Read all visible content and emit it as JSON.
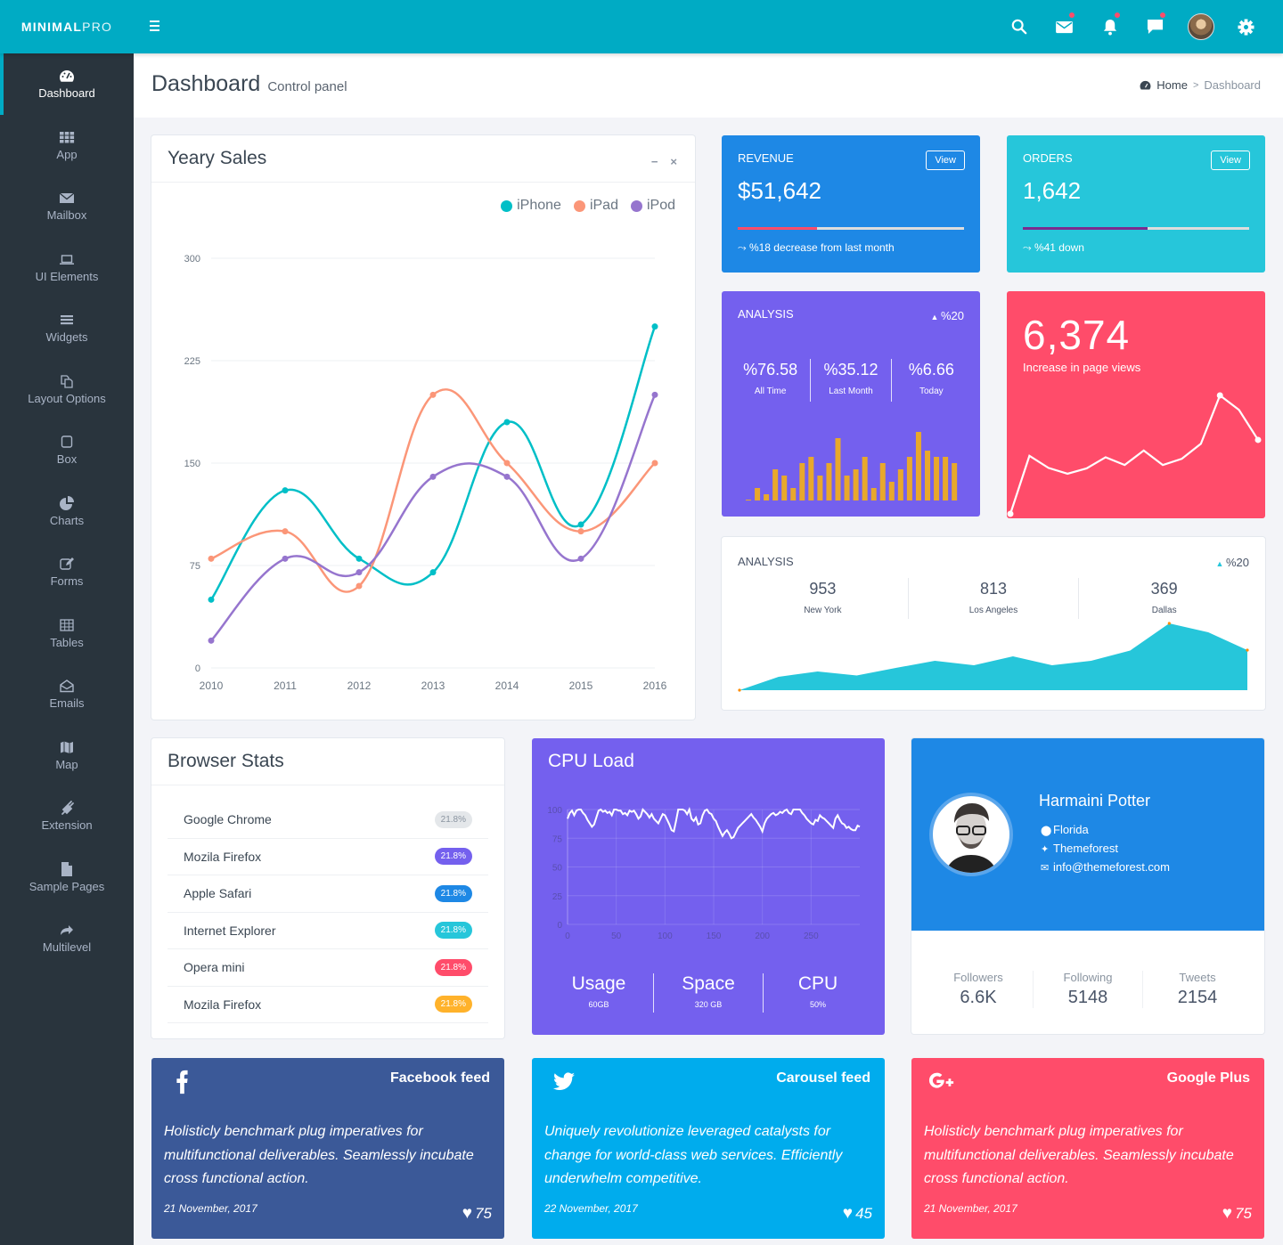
{
  "brand": {
    "bold": "MINIMAL",
    "light": "PRO"
  },
  "topbar": {
    "icons": [
      {
        "name": "search-icon",
        "badge": false
      },
      {
        "name": "mail-icon",
        "badge": true
      },
      {
        "name": "bell-icon",
        "badge": true
      },
      {
        "name": "chat-icon",
        "badge": true
      },
      {
        "name": "user-avatar",
        "badge": false
      },
      {
        "name": "gear-icon",
        "badge": false
      }
    ],
    "notification_color": "#ff4c6a"
  },
  "sidebar": {
    "items": [
      {
        "label": "Dashboard",
        "icon": "dashboard-icon",
        "active": true
      },
      {
        "label": "App",
        "icon": "grid-icon"
      },
      {
        "label": "Mailbox",
        "icon": "envelope-icon"
      },
      {
        "label": "UI Elements",
        "icon": "laptop-icon"
      },
      {
        "label": "Widgets",
        "icon": "bars-icon"
      },
      {
        "label": "Layout Options",
        "icon": "copy-icon"
      },
      {
        "label": "Box",
        "icon": "square-icon"
      },
      {
        "label": "Charts",
        "icon": "pie-chart-icon"
      },
      {
        "label": "Forms",
        "icon": "edit-icon"
      },
      {
        "label": "Tables",
        "icon": "table-icon"
      },
      {
        "label": "Emails",
        "icon": "envelope-open-icon"
      },
      {
        "label": "Map",
        "icon": "map-icon"
      },
      {
        "label": "Extension",
        "icon": "plug-icon"
      },
      {
        "label": "Sample Pages",
        "icon": "file-icon"
      },
      {
        "label": "Multilevel",
        "icon": "share-icon"
      }
    ]
  },
  "header": {
    "title": "Dashboard",
    "subtitle": "Control panel",
    "breadcrumb": {
      "home": "Home",
      "separator": ">",
      "current": "Dashboard"
    }
  },
  "yearly_sales": {
    "title": "Yeary Sales",
    "minimize": "−",
    "close": "×"
  },
  "revenue": {
    "label": "REVENUE",
    "button": "View",
    "value": "$51,642",
    "progress": 0.35,
    "bar_color": "#ff4c6a",
    "footer": "%18 decrease from last month",
    "bg": "#1e88e5"
  },
  "orders": {
    "label": "ORDERS",
    "button": "View",
    "value": "1,642",
    "progress": 0.55,
    "bar_color": "#7b2b8e",
    "footer": "%41 down",
    "bg": "#26c6da"
  },
  "analysis_purple": {
    "label": "ANALYSIS",
    "change": "%20",
    "stats": [
      {
        "value": "%76.58",
        "label": "All Time"
      },
      {
        "value": "%35.12",
        "label": "Last Month"
      },
      {
        "value": "%6.66",
        "label": "Today"
      }
    ],
    "bars": [
      0,
      2,
      1,
      5,
      4,
      2,
      6,
      7,
      4,
      6,
      10,
      4,
      5,
      7,
      2,
      6,
      3,
      5,
      7,
      11,
      8,
      7,
      7,
      6
    ],
    "bar_color": "#e8a82c",
    "bg": "#7460ee"
  },
  "page_views": {
    "value": "6,374",
    "label": "Increase in page views",
    "series": [
      0,
      12,
      9.5,
      8.3,
      9.4,
      11.7,
      10.1,
      13.1,
      10.1,
      11.4,
      14.5,
      24.5,
      21.5,
      15.3
    ],
    "bg": "#ff4c6a"
  },
  "analysis_cities": {
    "label": "ANALYSIS",
    "change": "%20",
    "stats": [
      {
        "value": "953",
        "label": "New York"
      },
      {
        "value": "813",
        "label": "Los Angeles"
      },
      {
        "value": "369",
        "label": "Dallas"
      }
    ],
    "series": [
      0,
      3,
      4.2,
      3.3,
      5,
      6.6,
      5.6,
      7.6,
      5.6,
      6.6,
      8.9,
      15,
      13,
      9
    ],
    "fill": "#26c6da"
  },
  "browser_stats": {
    "title": "Browser Stats",
    "rows": [
      {
        "name": "Google Chrome",
        "value": "21.8%",
        "color": "#e4e7ea",
        "text": "#8a94a0"
      },
      {
        "name": "Mozila Firefox",
        "value": "21.8%",
        "color": "#7460ee",
        "text": "#ffffff"
      },
      {
        "name": "Apple Safari",
        "value": "21.8%",
        "color": "#1e88e5",
        "text": "#ffffff"
      },
      {
        "name": "Internet Explorer",
        "value": "21.8%",
        "color": "#26c6da",
        "text": "#ffffff"
      },
      {
        "name": "Opera mini",
        "value": "21.8%",
        "color": "#ff4c6a",
        "text": "#ffffff"
      },
      {
        "name": "Mozila Firefox",
        "value": "21.8%",
        "color": "#ffb22b",
        "text": "#ffffff"
      }
    ]
  },
  "cpu_load": {
    "title": "CPU Load",
    "stats": [
      {
        "label": "Usage",
        "value": "60GB"
      },
      {
        "label": "Space",
        "value": "320 GB"
      },
      {
        "label": "CPU",
        "value": "50%"
      }
    ],
    "bg": "#7460ee"
  },
  "profile": {
    "name": "Harmaini Potter",
    "location": "Florida",
    "twitter": "Themeforest",
    "email": "info@themeforest.com",
    "stats": [
      {
        "label": "Followers",
        "value": "6.6K"
      },
      {
        "label": "Following",
        "value": "5148"
      },
      {
        "label": "Tweets",
        "value": "2154"
      }
    ],
    "bg": "#1e88e5"
  },
  "feeds": [
    {
      "icon": "facebook-icon",
      "title": "Facebook feed",
      "text": "Holisticly benchmark plug imperatives for multifunctional deliverables. Seamlessly incubate cross functional action.",
      "date": "21 November, 2017",
      "likes": "75",
      "bg": "#3b5998"
    },
    {
      "icon": "twitter-icon",
      "title": "Carousel feed",
      "text": "Uniquely revolutionize leveraged catalysts for change for world-class web services. Efficiently underwhelm competitive.",
      "date": "22 November, 2017",
      "likes": "45",
      "bg": "#00aced"
    },
    {
      "icon": "google-plus-icon",
      "title": "Google Plus",
      "text": "Holisticly benchmark plug imperatives for multifunctional deliverables. Seamlessly incubate cross functional action.",
      "date": "21 November, 2017",
      "likes": "75",
      "bg": "#ff4c6a"
    }
  ],
  "chart_data": [
    {
      "type": "line",
      "title": "Yeary Sales",
      "categories": [
        "2010",
        "2011",
        "2012",
        "2013",
        "2014",
        "2015",
        "2016"
      ],
      "series": [
        {
          "name": "iPhone",
          "color": "#00bfc7",
          "values": [
            50,
            130,
            80,
            70,
            180,
            105,
            250
          ]
        },
        {
          "name": "iPad",
          "color": "#fb9678",
          "values": [
            80,
            100,
            60,
            200,
            150,
            100,
            150
          ]
        },
        {
          "name": "iPod",
          "color": "#9675ce",
          "values": [
            20,
            80,
            70,
            140,
            140,
            80,
            200
          ]
        }
      ],
      "ylim": [
        0,
        300
      ],
      "yticks": [
        "0",
        "75",
        "150",
        "225",
        "300"
      ],
      "legend": "top-right",
      "grid": true
    },
    {
      "type": "line",
      "title": "CPU Load",
      "xlim": [
        0,
        300
      ],
      "ylim": [
        0,
        100
      ],
      "xticks": [
        "0",
        "50",
        "100",
        "150",
        "200",
        "250"
      ],
      "yticks": [
        "0",
        "25",
        "50",
        "75",
        "100"
      ],
      "grid": true,
      "series": [
        {
          "name": "CPU",
          "color": "#ffffff",
          "values": [
            92,
            97,
            99,
            95,
            99,
            100,
            100,
            97,
            95,
            91,
            88,
            85,
            87,
            93,
            99,
            100,
            98,
            99,
            97,
            98,
            95,
            100,
            100,
            99,
            99,
            96,
            97,
            95,
            99,
            98,
            99,
            96,
            92,
            94,
            100,
            98,
            96,
            93,
            96,
            92,
            90,
            88,
            92,
            96,
            95,
            91,
            87,
            82,
            81,
            90,
            100,
            100,
            100,
            99,
            96,
            100,
            92,
            90,
            93,
            87,
            88,
            95,
            99,
            100,
            97,
            96,
            92,
            90,
            85,
            81,
            77,
            80,
            82,
            79,
            75,
            76,
            80,
            84,
            86,
            88,
            90,
            92,
            94,
            96,
            93,
            91,
            88,
            85,
            81,
            88,
            92,
            94,
            96,
            97,
            95,
            96,
            98,
            97,
            99,
            100,
            97,
            96,
            100,
            100,
            100,
            100,
            97,
            95,
            92,
            90,
            88,
            87,
            91,
            90,
            95,
            93,
            92,
            90,
            88,
            86,
            84,
            92,
            95,
            91,
            88,
            87,
            84,
            85,
            83,
            82,
            82,
            86,
            85
          ]
        }
      ]
    },
    {
      "type": "bar",
      "title": "Analysis",
      "values": [
        0,
        2,
        1,
        5,
        4,
        2,
        6,
        7,
        4,
        6,
        10,
        4,
        5,
        7,
        2,
        6,
        3,
        5,
        7,
        11,
        8,
        7,
        7,
        6
      ]
    },
    {
      "type": "line",
      "title": "Increase in page views",
      "values": [
        0,
        12,
        9.5,
        8.3,
        9.4,
        11.7,
        10.1,
        13.1,
        10.1,
        11.4,
        14.5,
        24.5,
        21.5,
        15.3
      ]
    },
    {
      "type": "area",
      "title": "Analysis",
      "values": [
        0,
        3,
        4.2,
        3.3,
        5,
        6.6,
        5.6,
        7.6,
        5.6,
        6.6,
        8.9,
        15,
        13,
        9
      ]
    }
  ]
}
